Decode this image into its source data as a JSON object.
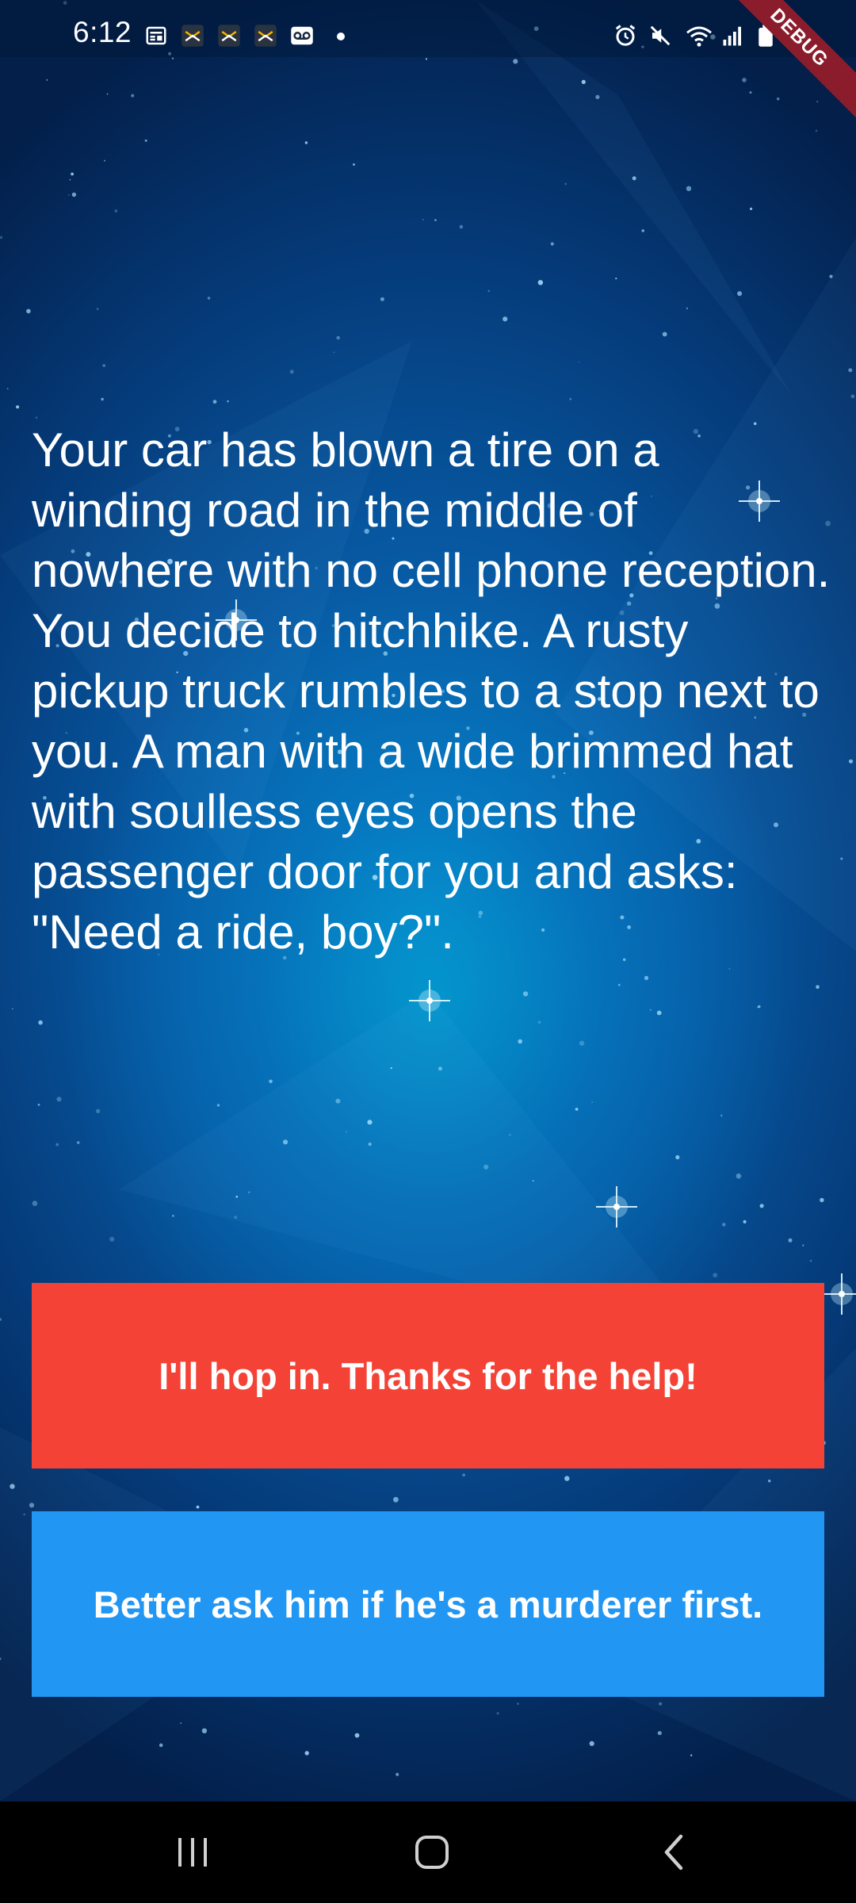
{
  "status_bar": {
    "time": "6:12",
    "left_icons": [
      "news-icon",
      "app-icon",
      "app-icon",
      "app-icon",
      "voicemail-icon",
      "dot-icon"
    ],
    "right_icons": [
      "alarm-icon",
      "mute-icon",
      "wifi-icon",
      "signal-icon",
      "battery-icon"
    ]
  },
  "debug_banner": "DEBUG",
  "story": {
    "text": "Your car has blown a tire on a winding road in the middle of nowhere with no cell phone reception. You decide to hitchhike. A rusty pickup truck rumbles to a stop next to you. A man with a wide brimmed hat with soulless eyes opens the passenger door for you and asks: \"Need a ride, boy?\"."
  },
  "choices": [
    {
      "label": "I'll hop in. Thanks for the help!",
      "color": "#f44336"
    },
    {
      "label": "Better ask him if he's a murderer first.",
      "color": "#2196f3"
    }
  ],
  "nav_bar": {
    "buttons": [
      "recents-icon",
      "home-icon",
      "back-icon"
    ]
  }
}
